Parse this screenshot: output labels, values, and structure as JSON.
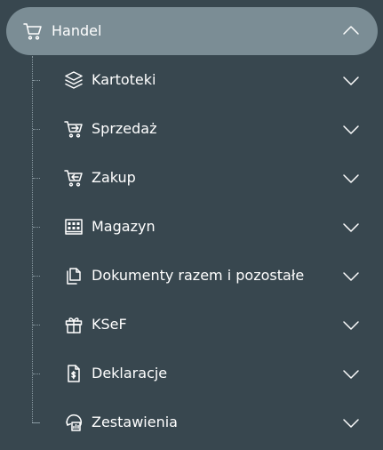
{
  "header": {
    "label": "Handel",
    "icon": "cart-icon",
    "expanded": true
  },
  "items": [
    {
      "label": "Kartoteki",
      "icon": "layers-icon"
    },
    {
      "label": "Sprzedaż",
      "icon": "cart-arrow-out-icon"
    },
    {
      "label": "Zakup",
      "icon": "cart-arrow-in-icon"
    },
    {
      "label": "Magazyn",
      "icon": "warehouse-icon"
    },
    {
      "label": "Dokumenty razem i pozostałe",
      "icon": "documents-icon"
    },
    {
      "label": "KSeF",
      "icon": "gift-icon"
    },
    {
      "label": "Deklaracje",
      "icon": "document-dollar-icon"
    },
    {
      "label": "Zestawienia",
      "icon": "report-refresh-icon"
    }
  ],
  "colors": {
    "background": "#38474f",
    "header_background": "#7b8d95",
    "text": "#ffffff",
    "tree_line": "#8a9aa2"
  }
}
